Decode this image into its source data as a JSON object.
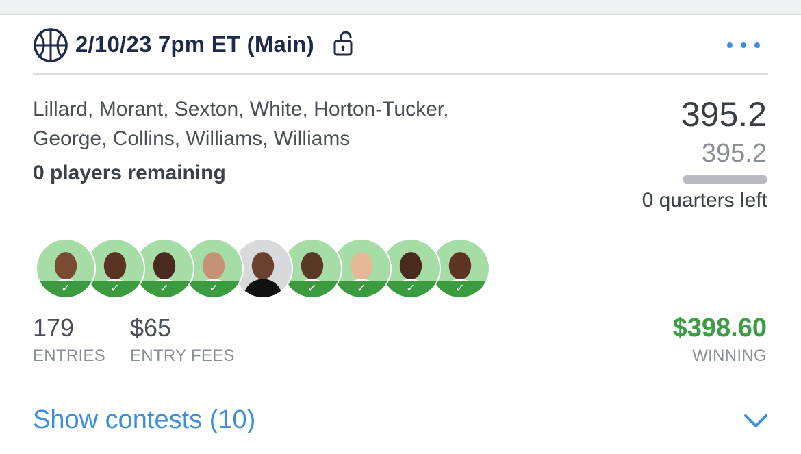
{
  "slate": {
    "title": "2/10/23 7pm ET (Main)",
    "sport_icon": "basketball-icon",
    "lock_icon": "unlocked-padlock-icon",
    "menu_icon": "more-dots-icon"
  },
  "lineup": {
    "players_line_1": "Lillard, Morant, Sexton, White, Horton-Tucker,",
    "players_line_2": "George, Collins, Williams, Williams",
    "remaining": "0 players remaining",
    "avatars": [
      {
        "checked": true
      },
      {
        "checked": true
      },
      {
        "checked": true
      },
      {
        "checked": true
      },
      {
        "checked": false
      },
      {
        "checked": true
      },
      {
        "checked": true
      },
      {
        "checked": true
      },
      {
        "checked": true
      }
    ],
    "check_glyph": "✓"
  },
  "score": {
    "current": "395.2",
    "projected": "395.2",
    "progress_fraction": 1.0,
    "time_left": "0 quarters left"
  },
  "stats": {
    "entries_value": "179",
    "entries_label": "ENTRIES",
    "fees_value": "$65",
    "fees_label": "ENTRY FEES",
    "winning_value": "$398.60",
    "winning_label": "WINNING"
  },
  "footer": {
    "show_contests": "Show contests (10)",
    "chevron_icon": "chevron-down-icon"
  },
  "colors": {
    "accent_blue": "#3d8fdc",
    "winning_green": "#3c9c44",
    "title_navy": "#1e2a4a",
    "check_green": "#3b9b3f",
    "avatar_bg_green": "#a6dca6"
  }
}
